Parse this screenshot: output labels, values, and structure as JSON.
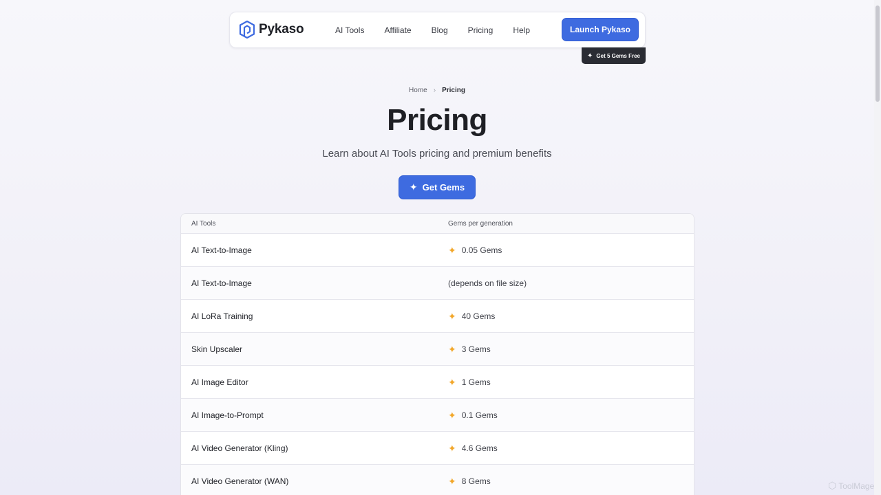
{
  "brand": {
    "name": "Pykaso",
    "icon": "hexagon-logo-icon",
    "accent": "#3e6be0",
    "gem_color": "#f2a72a"
  },
  "nav": {
    "links": [
      "AI Tools",
      "Affiliate",
      "Blog",
      "Pricing",
      "Help"
    ],
    "launch_label": "Launch Pykaso",
    "gems_free_label": "Get 5 Gems Free"
  },
  "breadcrumb": {
    "home": "Home",
    "current": "Pricing"
  },
  "page": {
    "title": "Pricing",
    "subtitle": "Learn about AI Tools pricing and premium benefits",
    "cta_label": "Get Gems"
  },
  "table": {
    "headers": [
      "AI Tools",
      "Gems per generation"
    ],
    "rows": [
      {
        "tool": "AI Text-to-Image",
        "gems": "0.05 Gems",
        "icon": true
      },
      {
        "tool": "AI Text-to-Image",
        "gems": "(depends on file size)",
        "icon": false
      },
      {
        "tool": "AI LoRa Training",
        "gems": "40 Gems",
        "icon": true
      },
      {
        "tool": "Skin Upscaler",
        "gems": "3 Gems",
        "icon": true
      },
      {
        "tool": "AI Image Editor",
        "gems": "1 Gems",
        "icon": true
      },
      {
        "tool": "AI Image-to-Prompt",
        "gems": "0.1 Gems",
        "icon": true
      },
      {
        "tool": "AI Video Generator (Kling)",
        "gems": "4.6 Gems",
        "icon": true
      },
      {
        "tool": "AI Video Generator (WAN)",
        "gems": "8 Gems",
        "icon": true
      }
    ]
  },
  "watermark": "ToolMage"
}
